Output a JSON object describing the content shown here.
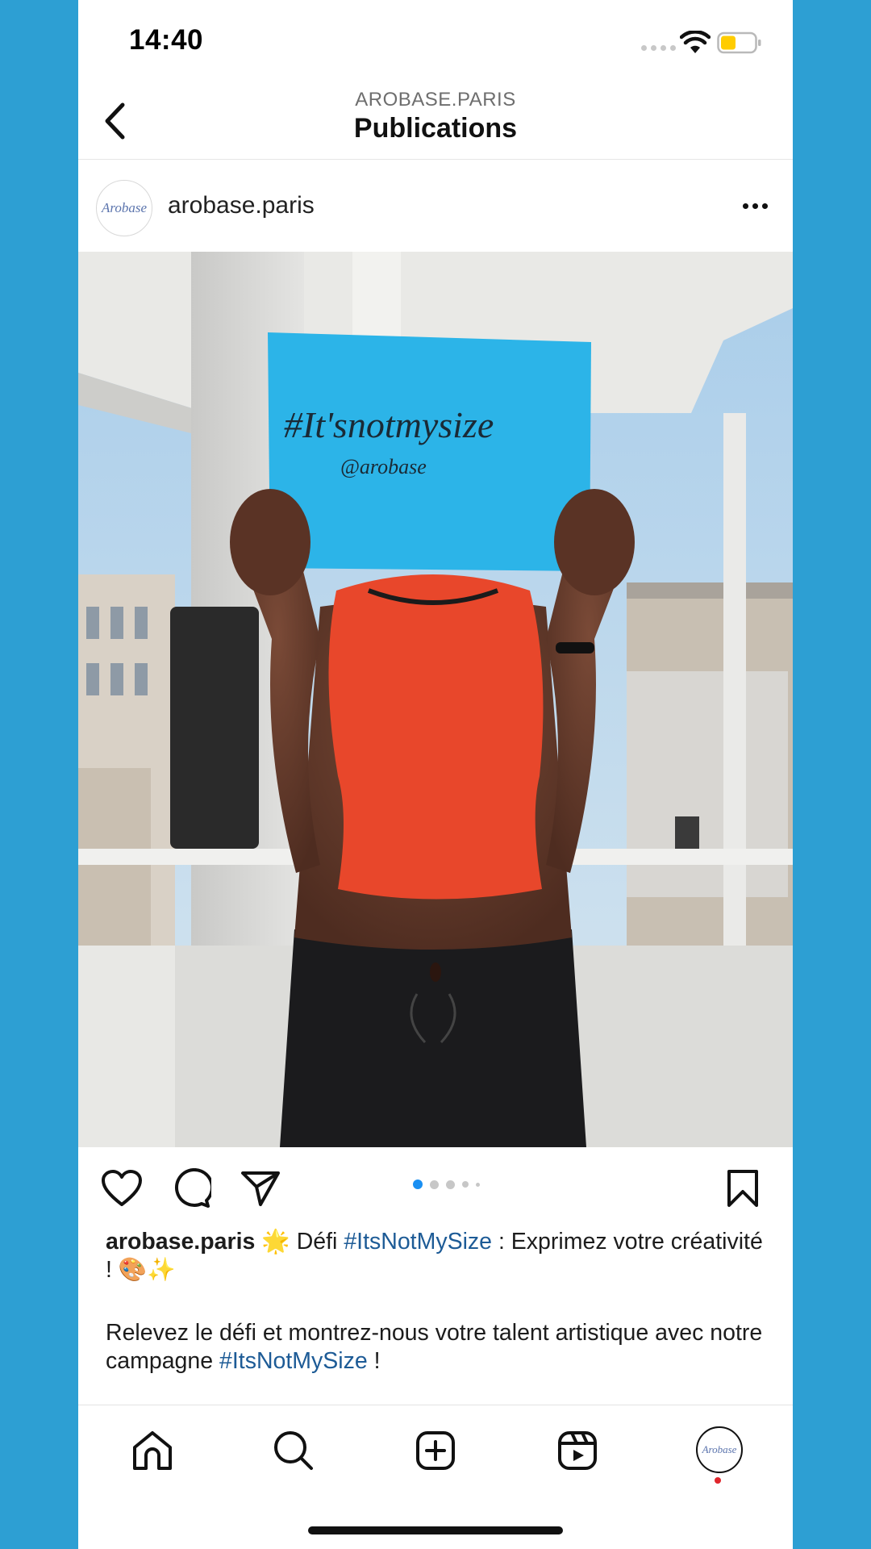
{
  "status_bar": {
    "time": "14:40"
  },
  "header": {
    "account": "AROBASE.PARIS",
    "title": "Publications"
  },
  "post": {
    "username": "arobase.paris",
    "avatar_text": "Arobase",
    "sign": {
      "hashtag": "#It'snotmysize",
      "handle": "@arobase"
    },
    "carousel": {
      "count": 5,
      "active": 1
    },
    "caption": {
      "line1_user": "arobase.paris",
      "line1_emoji": "🌟",
      "line1_pre": " Défi ",
      "line1_tag": "#ItsNotMySize",
      "line1_post": " : Exprimez votre créativité ! 🎨✨",
      "line2_pre": "Relevez le défi et montrez-nous votre talent artistique avec notre campagne ",
      "line2_tag": "#ItsNotMySize",
      "line2_post": " !"
    }
  },
  "icons": {
    "back": "chevron-left-icon",
    "more": "more-horizontal-icon",
    "like": "heart-icon",
    "comment": "comment-icon",
    "share": "send-icon",
    "save": "bookmark-icon",
    "home": "home-icon",
    "search": "search-icon",
    "create": "plus-square-icon",
    "reels": "reels-icon"
  },
  "colors": {
    "background": "#2d9fd3",
    "hashtag": "#1d5b96",
    "carousel_active": "#1a8ff2",
    "notification": "#e0262c",
    "sign": "#2cb4e8",
    "top": "#e8472b"
  }
}
